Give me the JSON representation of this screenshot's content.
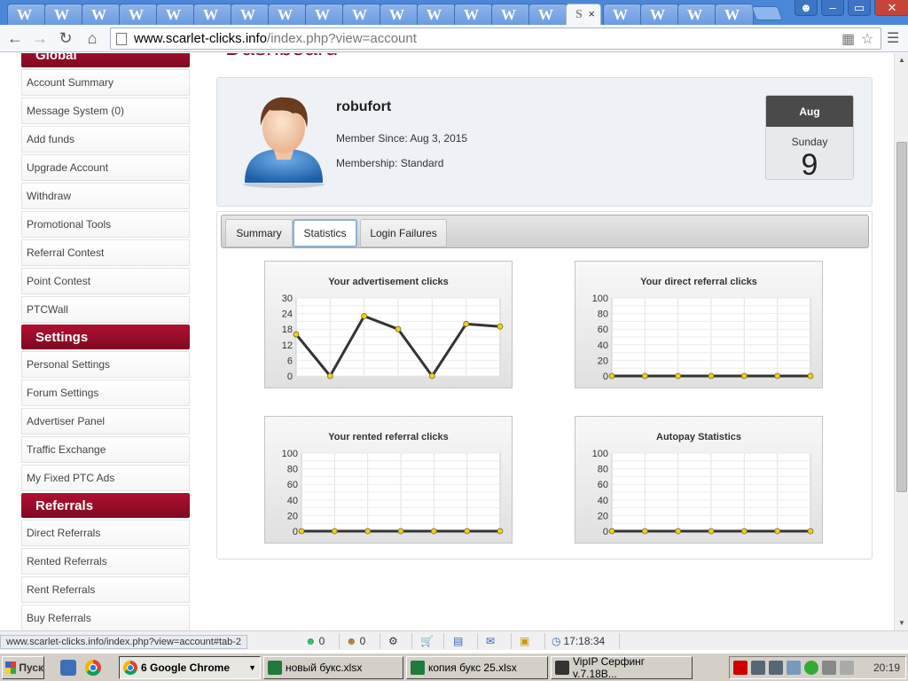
{
  "browser": {
    "tab_favicon": "W",
    "active_tab_favicon": "S",
    "active_tab_close": "×",
    "window_controls": {
      "user": "user-icon",
      "minimize": "–",
      "restore": "▭",
      "close": "✕"
    },
    "url_host": "www.scarlet-clicks.info",
    "url_path": "/index.php?view=account"
  },
  "sidebar": {
    "groups": [
      {
        "title": "Global",
        "items": [
          "Account Summary",
          "Message System (0)",
          "Add funds",
          "Upgrade Account",
          "Withdraw",
          "Promotional Tools",
          "Referral Contest",
          "Point Contest",
          "PTCWall"
        ]
      },
      {
        "title": "Settings",
        "items": [
          "Personal Settings",
          "Forum Settings",
          "Advertiser Panel",
          "Traffic Exchange",
          "My Fixed PTC Ads"
        ]
      },
      {
        "title": "Referrals",
        "items": [
          "Direct Referrals",
          "Rented Referrals",
          "Rent Referrals",
          "Buy Referrals"
        ]
      }
    ]
  },
  "page": {
    "title": "Dashboard"
  },
  "profile": {
    "username": "robufort",
    "member_since": "Member Since: Aug 3, 2015",
    "membership": "Membership: Standard",
    "calendar": {
      "month": "Aug",
      "weekday": "Sunday",
      "day": "9"
    }
  },
  "tabs": [
    {
      "label": "Summary",
      "active": false
    },
    {
      "label": "Statistics",
      "active": true
    },
    {
      "label": "Login Failures",
      "active": false
    }
  ],
  "chart_data": [
    {
      "type": "line",
      "title": "Your advertisement clicks",
      "ylim": [
        0,
        30
      ],
      "yticks": [
        0,
        6,
        12,
        18,
        24,
        30
      ],
      "values": [
        16,
        0,
        23,
        18,
        0,
        20,
        19
      ]
    },
    {
      "type": "line",
      "title": "Your direct referral clicks",
      "ylim": [
        0,
        100
      ],
      "yticks": [
        0,
        20,
        40,
        60,
        80,
        100
      ],
      "values": [
        0,
        0,
        0,
        0,
        0,
        0,
        0
      ]
    },
    {
      "type": "line",
      "title": "Your rented referral clicks",
      "ylim": [
        0,
        100
      ],
      "yticks": [
        0,
        20,
        40,
        60,
        80,
        100
      ],
      "values": [
        0,
        0,
        0,
        0,
        0,
        0,
        0
      ]
    },
    {
      "type": "line",
      "title": "Autopay Statistics",
      "ylim": [
        0,
        100
      ],
      "yticks": [
        0,
        20,
        40,
        60,
        80,
        100
      ],
      "values": [
        0,
        0,
        0,
        0,
        0,
        0,
        0
      ]
    }
  ],
  "colors": {
    "accent": "#8a1126",
    "line": "#333333",
    "marker": "#f0d020"
  },
  "statusbar": {
    "url": "www.scarlet-clicks.info/index.php?view=account#tab-2",
    "counter1": "0",
    "counter2": "0",
    "time": "17:18:34"
  },
  "taskbar": {
    "start": "Пуск",
    "tasks": [
      "6 Google Chrome",
      "новый букс.xlsx",
      "копия букс 25.xlsx",
      "VipIP Серфинг  v.7.18B..."
    ],
    "clock": "20:19"
  }
}
